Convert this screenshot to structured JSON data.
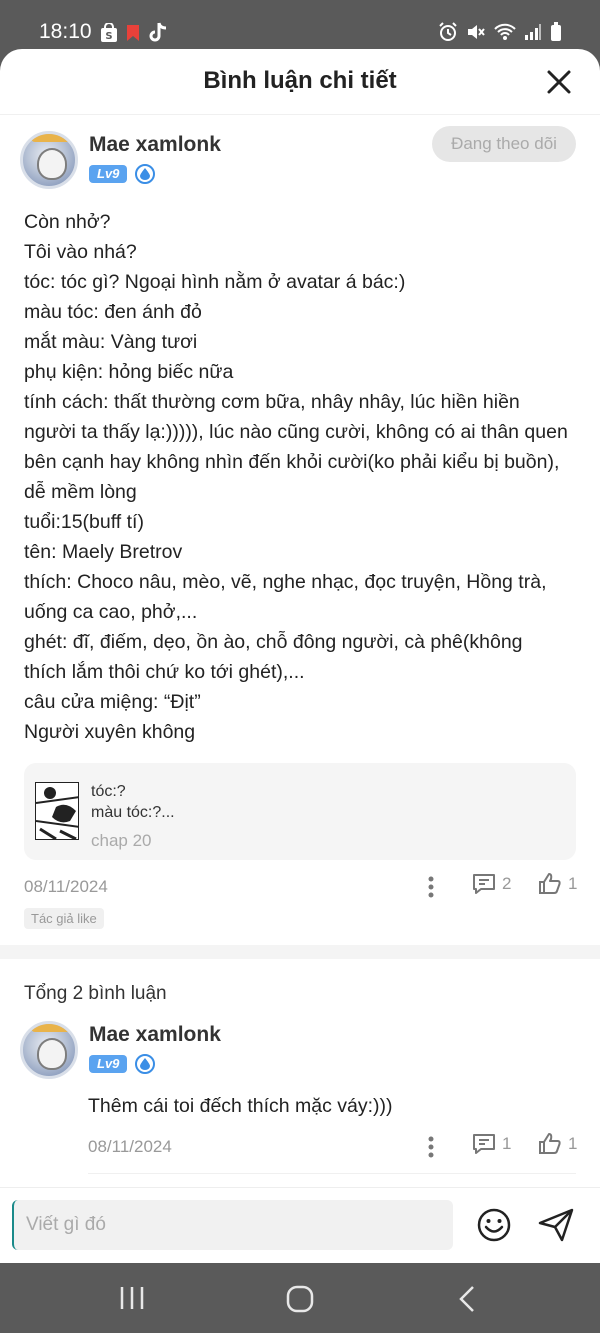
{
  "status_bar": {
    "time": "18:10",
    "left_icons": [
      "shopping-bag-icon",
      "bookmark-icon",
      "tiktok-icon"
    ],
    "right_icons": [
      "alarm-icon",
      "mute-icon",
      "wifi-icon",
      "signal-icon",
      "battery-icon"
    ]
  },
  "header": {
    "title": "Bình luận chi tiết"
  },
  "comment": {
    "user_name": "Mae xamlonk",
    "level": "Lv9",
    "follow_label": "Đang theo dõi",
    "text": "Còn nhở?\nTôi vào nhá?\ntóc: tóc gì? Ngoại hình nằm ở avatar á bác:)\nmàu tóc: đen ánh đỏ\nmắt màu: Vàng tươi\nphụ kiện: hỏng biếc nữa\ntính cách: thất thường cơm bữa, nhây nhây, lúc hiền hiền người ta thấy lạ:))))), lúc nào cũng cười, không có ai thân quen bên cạnh hay không nhìn đến khỏi cười(ko phải kiểu bị buồn), dễ mềm lòng\ntuổi:15(buff tí)\ntên: Maely Bretrov\nthích: Choco nâu, mèo, vẽ, nghe nhạc, đọc truyện, Hồng trà, uống ca cao, phở,...\nghét: đĩ, điếm, dẹo, ồn ào, chỗ đông người, cà phê(không thích lắm thôi chứ ko tới ghét),...\ncâu cửa miệng: “Địt”\nNgười xuyên không",
    "quote": {
      "line1": "tóc:?",
      "line2": "màu tóc:?...",
      "chapter": "chap 20"
    },
    "date": "08/11/2024",
    "reply_count": "2",
    "like_count": "1",
    "author_like": "Tác giả like"
  },
  "replies_section": {
    "total_label": "Tổng 2 bình luận"
  },
  "reply": {
    "user_name": "Mae xamlonk",
    "level": "Lv9",
    "text": "Thêm cái toi đếch thích mặc váy:)))",
    "date": "08/11/2024",
    "reply_count": "1",
    "like_count": "1"
  },
  "input": {
    "placeholder": "Viết gì đó"
  },
  "colors": {
    "level_badge": "#5aa3f0",
    "accent_cursor": "#1a8a8a",
    "muted_text": "#999999"
  }
}
